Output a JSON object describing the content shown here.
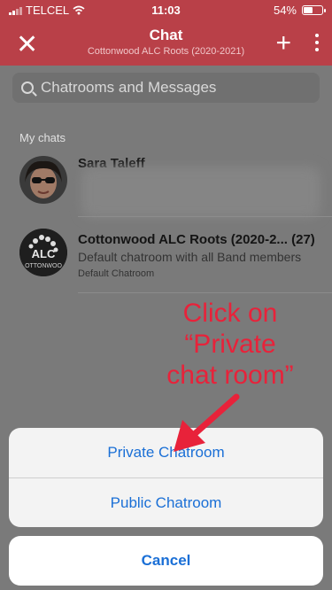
{
  "status_bar": {
    "carrier": "TELCEL",
    "time": "11:03",
    "battery": "54%",
    "battery_level": 0.54
  },
  "header": {
    "title": "Chat",
    "subtitle": "Cottonwood ALC Roots (2020-2021)"
  },
  "search": {
    "placeholder": "Chatrooms and Messages"
  },
  "chats": {
    "section_label": "My chats",
    "items": [
      {
        "name": "Sara Taleff"
      },
      {
        "name": "Cottonwood ALC Roots (2020-2... (27)",
        "description": "Default chatroom with all Band members",
        "meta": "Default Chatroom",
        "avatar_text": "ALC",
        "avatar_subtext": "OTTONWOO"
      }
    ]
  },
  "annotation": {
    "lines": [
      "Click on",
      "“Private",
      "chat room”"
    ],
    "color": "#e8223a"
  },
  "action_sheet": {
    "options": [
      "Private Chatroom",
      "Public Chatroom"
    ],
    "cancel": "Cancel"
  },
  "colors": {
    "header_bg": "#b94048",
    "action_blue": "#1a6fd6"
  }
}
